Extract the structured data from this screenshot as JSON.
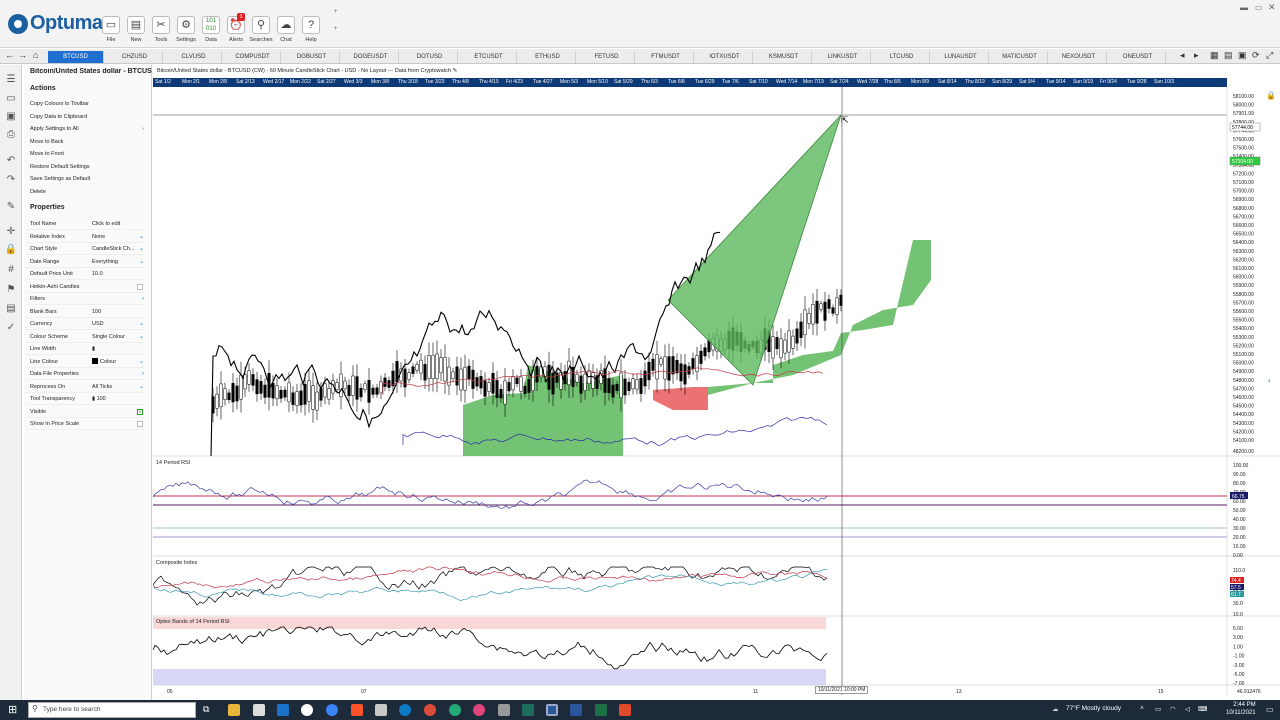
{
  "app": {
    "brand": "Optuma"
  },
  "toolbar": {
    "buttons": [
      {
        "label": "File",
        "icon": "folder-icon"
      },
      {
        "label": "New",
        "icon": "new-document-icon"
      },
      {
        "label": "Tools",
        "icon": "tools-icon"
      },
      {
        "label": "Settings",
        "icon": "gear-icon"
      },
      {
        "label": "Data",
        "icon": "data-icon"
      },
      {
        "label": "Alerts",
        "icon": "alarm-clock-icon",
        "badge": "3"
      },
      {
        "label": "Searches",
        "icon": "search-icon"
      },
      {
        "label": "Chat",
        "icon": "chat-icon"
      },
      {
        "label": "Help",
        "icon": "help-icon"
      }
    ]
  },
  "tabs": [
    "BTCUSD",
    "CHZUSD",
    "CLVUSD",
    "COMPUSDT",
    "DGBUSDT",
    "DOGEUSDT",
    "DOTUSD",
    "ETCUSDT",
    "ETHUSD",
    "FETUSD",
    "FTMUSDT",
    "IOTXUSDT",
    "KSMUSDT",
    "LINKUSDT",
    "LTCUSD",
    "LUNAUSDT",
    "MATICUSDT",
    "NEXOUSDT",
    "ONEUSDT"
  ],
  "panel": {
    "title": "Bitcoin/United States dollar - BTCUSD",
    "actions_heading": "Actions",
    "actions": [
      "Copy Colours to Toolbar",
      "Copy Data to Clipboard",
      "Apply Settings to All",
      "Move to Back",
      "Move to Front",
      "Restore Default Settings",
      "Save Settings as Default",
      "Delete"
    ],
    "properties_heading": "Properties",
    "properties": [
      {
        "k": "Tool Name",
        "v": "Click to edit"
      },
      {
        "k": "Relative Index",
        "v": "None"
      },
      {
        "k": "Chart Style",
        "v": "CandleStick Ch..."
      },
      {
        "k": "Date Range",
        "v": "Everything"
      },
      {
        "k": "Default Price Unit",
        "v": "10.0"
      },
      {
        "k": "Heikin-Ashi Candles",
        "v": ""
      },
      {
        "k": "Filters",
        "v": ""
      },
      {
        "k": "Blank Bars",
        "v": "100"
      },
      {
        "k": "Currency",
        "v": "USD"
      },
      {
        "k": "Colour Scheme",
        "v": "Single Colour"
      },
      {
        "k": "Line Width",
        "v": ""
      },
      {
        "k": "Line Colour",
        "v": "Colour"
      },
      {
        "k": "Data File Properties",
        "v": ""
      },
      {
        "k": "Reprocess On",
        "v": "All Ticks"
      },
      {
        "k": "Tool Transparency",
        "v": "100"
      },
      {
        "k": "Visible",
        "v": ""
      },
      {
        "k": "Show In Price Scale",
        "v": ""
      }
    ]
  },
  "chart": {
    "title": "Bitcoin/United States dollar - BTCUSD (CW) - 60 Minute CandleStick Chart - USD - No Layout --- Data from Cryptowatch",
    "dates": [
      "Sat 1/2",
      "Mon 2/1",
      "Mon 2/8",
      "Sat 2/13",
      "Wed 2/17",
      "Mon 2/22",
      "Sat 2/27",
      "Wed 3/3",
      "Mon 3/8",
      "Thu 3/18",
      "Tue 3/23",
      "Thu 4/8",
      "Thu 4/15",
      "Fri 4/23",
      "Tue 4/27",
      "Mon 5/3",
      "Mon 5/10",
      "Sat 5/29",
      "Thu 6/3",
      "Tue 6/8",
      "Tue 6/29",
      "Tue 7/6",
      "Sat 7/10",
      "Wed 7/14",
      "Mon 7/19",
      "Sat 7/24",
      "Wed 7/28",
      "Thu 8/5",
      "Mon 8/9",
      "Sat 8/14",
      "Thu 8/19",
      "Sun 8/29",
      "Sat 9/4",
      "Tue 9/14",
      "Sun 9/19",
      "Fri 9/24",
      "Tue 9/28",
      "Sun 10/3"
    ],
    "price_ticks": [
      "58100.00",
      "58000.00",
      "57901.99",
      "57800.00",
      "57744.00",
      "57600.00",
      "57500.00",
      "57400.00",
      "57304.00",
      "57200.00",
      "57100.00",
      "57000.00",
      "56900.00",
      "56800.00",
      "56700.00",
      "56600.00",
      "56500.00",
      "56400.00",
      "56300.00",
      "56200.00",
      "56100.00",
      "56000.00",
      "55900.00",
      "55800.00",
      "55700.00",
      "55600.00",
      "55500.00",
      "55400.00",
      "55300.00",
      "55200.00",
      "55100.00",
      "55000.00",
      "54900.00",
      "54800.00",
      "54700.00",
      "54600.00",
      "54500.00",
      "54400.00",
      "54300.00",
      "54200.00",
      "54100.00",
      "48200.00"
    ],
    "current_price": "57304.00",
    "cross_price": "57744.00",
    "rsi": {
      "label": "14 Period RSI",
      "ticks": [
        "100.00",
        "90.00",
        "80.00",
        "70.00",
        "60.00",
        "50.00",
        "40.00",
        "30.00",
        "20.00",
        "10.00",
        "0.00"
      ],
      "value": "66.75"
    },
    "composite": {
      "label": "Composite Index",
      "ticks": [
        "110.0",
        "70.0",
        "50.0",
        "30.0",
        "10.0"
      ],
      "values": [
        "74.4",
        "57.5",
        "61.7"
      ]
    },
    "optex": {
      "label": "Optex Bands of 14 Period RSI",
      "ticks": [
        "5.00",
        "3.00",
        "1.00",
        "-1.00",
        "-3.00",
        "-5.00",
        "-7.00"
      ]
    },
    "x_labels": [
      "05",
      "07",
      "11",
      "13",
      "15"
    ],
    "cursor_time": "10/11/2021 10:00 PM",
    "cursor_value": "46.912476"
  },
  "taskbar": {
    "search_placeholder": "Type here to search",
    "weather": "77°F  Mostly cloudy",
    "time": "2:44 PM",
    "date": "10/11/2021"
  },
  "colors": {
    "accent": "#1f6fd0",
    "cloud_green": "#5cb85c",
    "cloud_red": "#e8585a",
    "date_bar": "#0e3a78"
  }
}
